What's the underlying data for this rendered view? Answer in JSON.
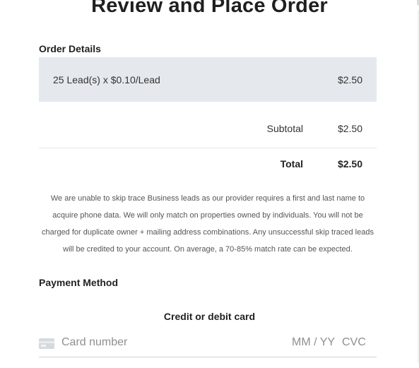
{
  "modal": {
    "title": "Review and Place Order"
  },
  "order": {
    "section_label": "Order Details",
    "line_item": {
      "description": "25 Lead(s) x $0.10/Lead",
      "amount": "$2.50"
    },
    "subtotal_label": "Subtotal",
    "subtotal_value": "$2.50",
    "total_label": "Total",
    "total_value": "$2.50"
  },
  "notice": "We are unable to skip trace Business leads as our provider requires a first and last name to acquire phone data. We will only match on properties owned by individuals. You will not be charged for duplicate owner + mailing address combinations. Any unsuccessful skip traced leads will be credited to your account. On average, a 70-85% match rate can be expected.",
  "payment": {
    "section_label": "Payment Method",
    "card_title": "Credit or debit card",
    "card_number_placeholder": "Card number",
    "expiry_placeholder": "MM / YY",
    "cvc_placeholder": "CVC",
    "card_icon": "credit-card-icon"
  },
  "colors": {
    "row_background": "#e5e9ed",
    "divider": "#e3e6ea",
    "text": "#333333"
  }
}
